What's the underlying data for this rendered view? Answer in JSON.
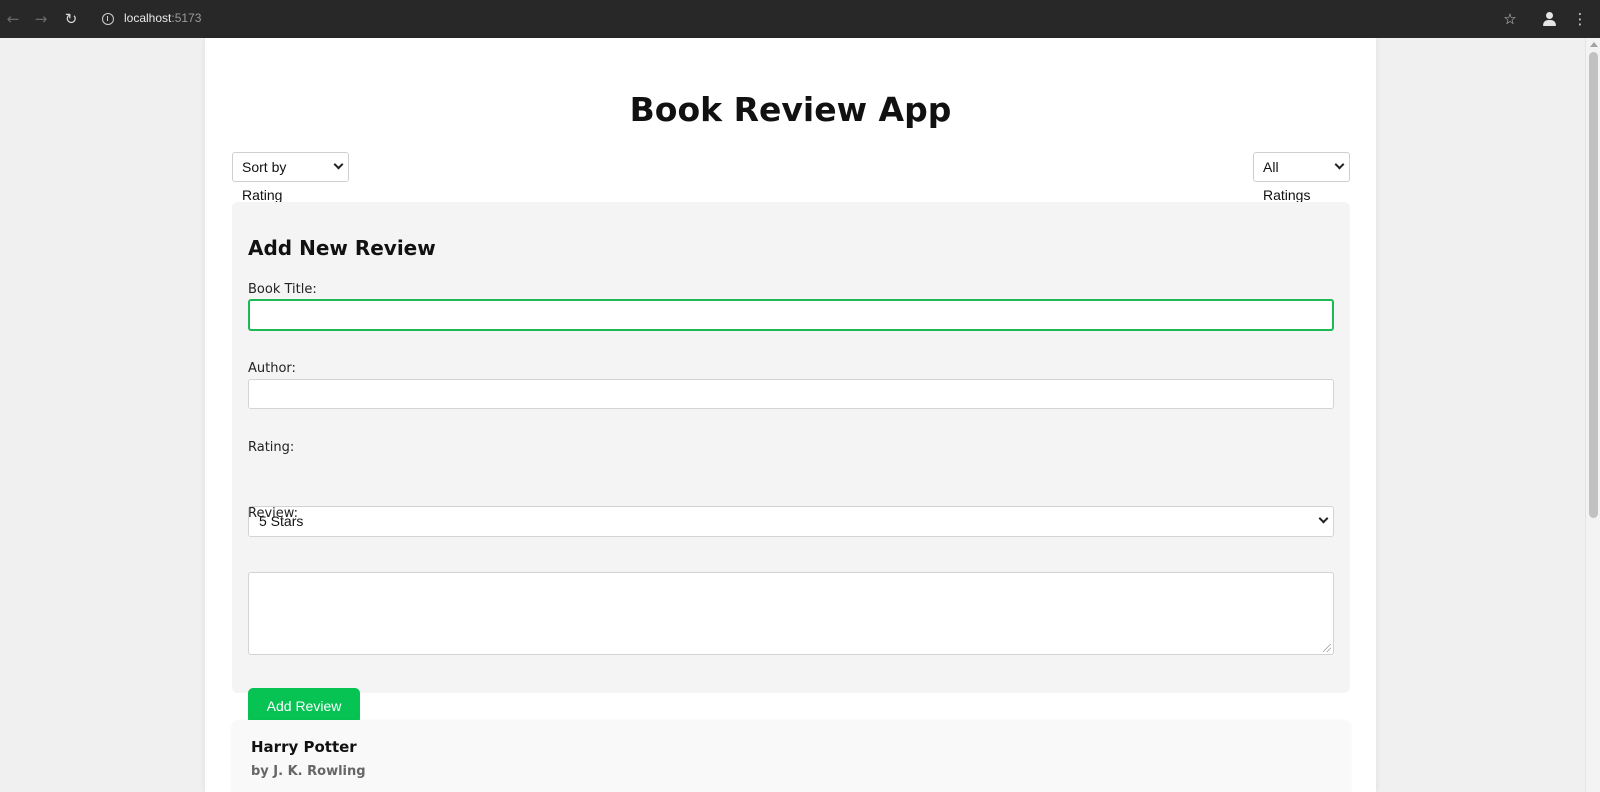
{
  "browser": {
    "url_host": "localhost",
    "url_port": ":5173",
    "icons": [
      "back-arrow-icon",
      "forward-arrow-icon",
      "reload-icon",
      "info-icon",
      "star-icon",
      "profile-icon",
      "kebab-menu-icon"
    ]
  },
  "page": {
    "title": "Book Review App"
  },
  "controls": {
    "sort_value": "Sort by Rating",
    "filter_value": "All Ratings"
  },
  "form": {
    "heading": "Add New Review",
    "title_label": "Book Title:",
    "title_value": "",
    "author_label": "Author:",
    "author_value": "",
    "rating_label": "Rating:",
    "rating_value": "5 Stars",
    "review_label": "Review:",
    "review_value": "",
    "submit_label": "Add Review"
  },
  "reviews": [
    {
      "title": "Harry Potter",
      "author": "by J. K. Rowling"
    }
  ],
  "colors": {
    "accent": "#07c354",
    "focus_border": "#1db954",
    "panel_bg": "#f4f4f4",
    "page_bg": "#f0f0f0"
  }
}
